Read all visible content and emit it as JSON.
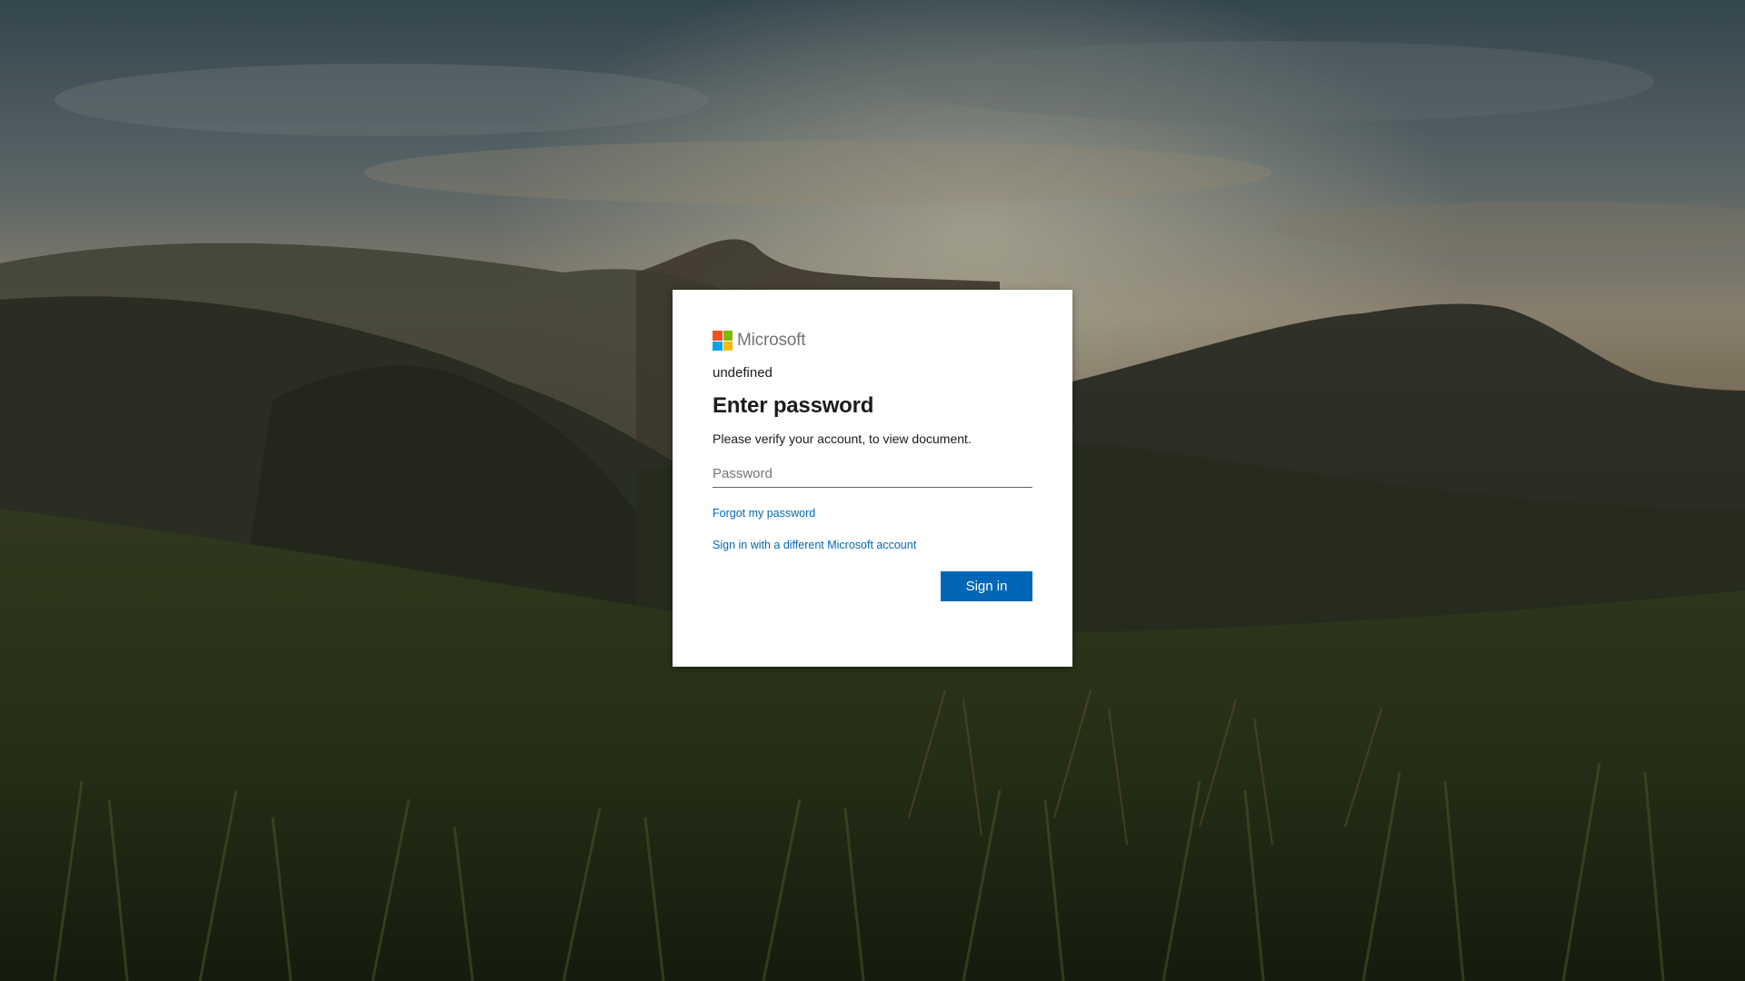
{
  "brand": {
    "name": "Microsoft",
    "colors": {
      "red": "#f25022",
      "green": "#7fba00",
      "blue": "#00a4ef",
      "yellow": "#ffb900"
    }
  },
  "signin": {
    "identity": "undefined",
    "title": "Enter password",
    "description": "Please verify your account, to view document.",
    "password_placeholder": "Password",
    "forgot_link": "Forgot my password",
    "different_account_link": "Sign in with a different Microsoft account",
    "submit_label": "Sign in"
  },
  "theme": {
    "accent": "#0067b8",
    "background": "dusk mountain landscape with grass foreground"
  }
}
